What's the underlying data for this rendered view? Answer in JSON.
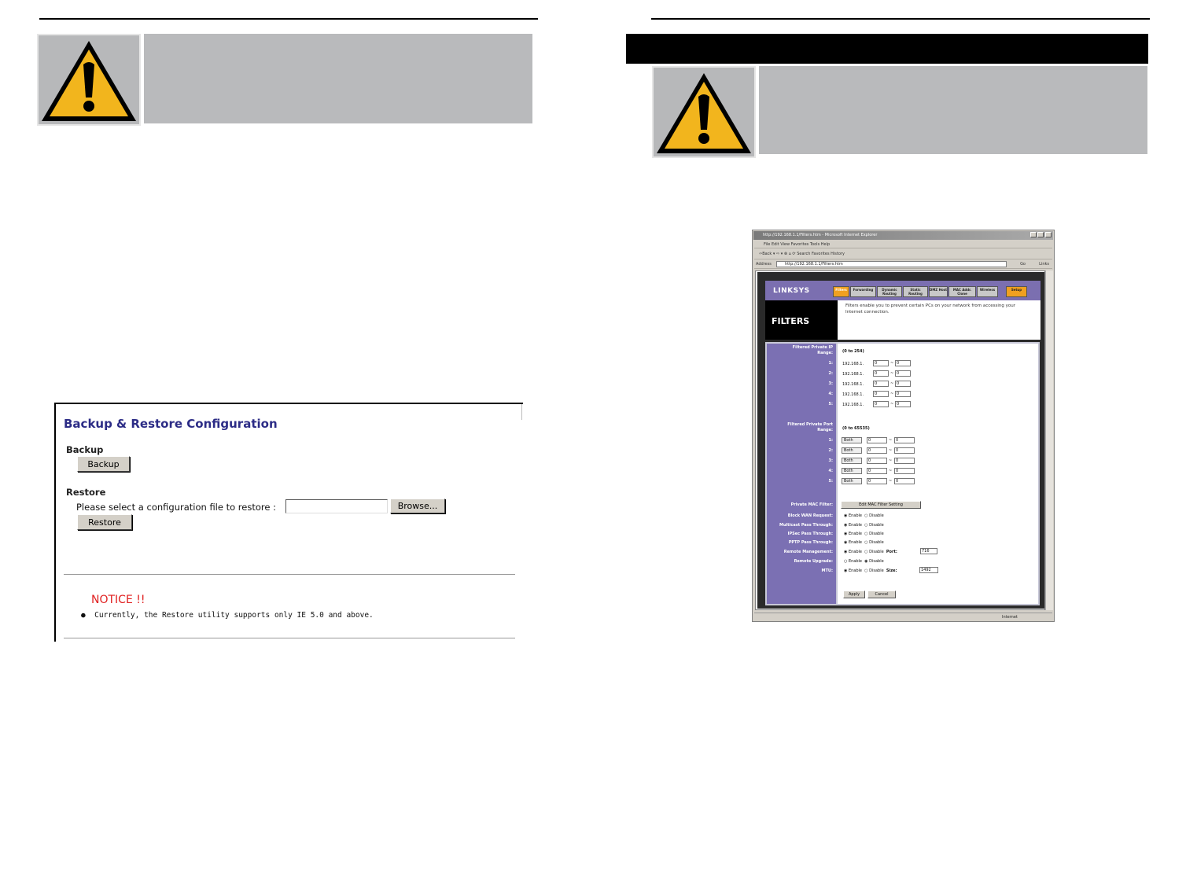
{
  "backup_restore": {
    "title": "Backup & Restore Configuration",
    "backup_heading": "Backup",
    "backup_button": "Backup",
    "restore_heading": "Restore",
    "restore_prompt": "Please select a configuration file to restore :",
    "browse_button": "Browse...",
    "restore_button": "Restore",
    "notice_title": "NOTICE !!",
    "notice_text": "Currently, the Restore utility supports only IE 5.0 and above."
  },
  "browser": {
    "title": "http://192.168.1.1/Filters.htm - Microsoft Internet Explorer",
    "menu": "File   Edit   View   Favorites   Tools   Help",
    "toolbar": "⇦Back  ▾  ⇨  ▾   ⊗   ⌂   ⟳   Search   Favorites   History",
    "address_label": "Address",
    "address_value": "http://192.168.1.1/Filters.htm",
    "go": "Go",
    "links": "Links",
    "status": "Internet"
  },
  "linksys": {
    "logo": "LINKSYS",
    "tabs": [
      "Filters",
      "Forwarding",
      "Dynamic Routing",
      "Static Routing",
      "DMZ Host",
      "MAC Addr. Clone",
      "Wireless",
      "Setup"
    ],
    "section_title": "FILTERS",
    "description": "Filters enable you to prevent certain PCs on your network from accessing your Internet connection.",
    "ip_range_label": "Filtered Private IP Range:",
    "ip_range_hint": "(0 to 254)",
    "ip_rows": [
      {
        "label": "1:",
        "prefix": "192.168.1.",
        "from": "0",
        "to": "0"
      },
      {
        "label": "2:",
        "prefix": "192.168.1.",
        "from": "0",
        "to": "0"
      },
      {
        "label": "3:",
        "prefix": "192.168.1.",
        "from": "0",
        "to": "0"
      },
      {
        "label": "4:",
        "prefix": "192.168.1.",
        "from": "0",
        "to": "0"
      },
      {
        "label": "5:",
        "prefix": "192.168.1.",
        "from": "0",
        "to": "0"
      }
    ],
    "port_range_label": "Filtered Private Port Range:",
    "port_range_hint": "(0 to 65535)",
    "port_rows": [
      {
        "label": "1:",
        "proto": "Both",
        "from": "0",
        "to": "0"
      },
      {
        "label": "2:",
        "proto": "Both",
        "from": "0",
        "to": "0"
      },
      {
        "label": "3:",
        "proto": "Both",
        "from": "0",
        "to": "0"
      },
      {
        "label": "4:",
        "proto": "Both",
        "from": "0",
        "to": "0"
      },
      {
        "label": "5:",
        "proto": "Both",
        "from": "0",
        "to": "0"
      }
    ],
    "mac_filter_label": "Private MAC Filter:",
    "mac_filter_button": "Edit MAC Filter Setting",
    "options": [
      {
        "label": "Block WAN Request:",
        "enable": "Enable",
        "disable": "Disable",
        "extra_label": "",
        "extra_value": ""
      },
      {
        "label": "Multicast Pass Through:",
        "enable": "Enable",
        "disable": "Disable",
        "extra_label": "",
        "extra_value": ""
      },
      {
        "label": "IPSec Pass Through:",
        "enable": "Enable",
        "disable": "Disable",
        "extra_label": "",
        "extra_value": ""
      },
      {
        "label": "PPTP Pass Through:",
        "enable": "Enable",
        "disable": "Disable",
        "extra_label": "",
        "extra_value": ""
      },
      {
        "label": "Remote Management:",
        "enable": "Enable",
        "disable": "Disable",
        "extra_label": "Port:",
        "extra_value": "716"
      },
      {
        "label": "Remote Upgrade:",
        "enable": "Enable",
        "disable": "Disable",
        "extra_label": "",
        "extra_value": ""
      },
      {
        "label": "MTU:",
        "enable": "Enable",
        "disable": "Disable",
        "extra_label": "Size:",
        "extra_value": "1492"
      }
    ],
    "apply_button": "Apply",
    "cancel_button": "Cancel"
  },
  "colors": {
    "warning_yellow": "#f2b51d",
    "panel_gray": "#b9babc",
    "linksys_purple": "#7b70b3",
    "notice_red": "#e02020",
    "title_blue": "#2c2c86"
  }
}
